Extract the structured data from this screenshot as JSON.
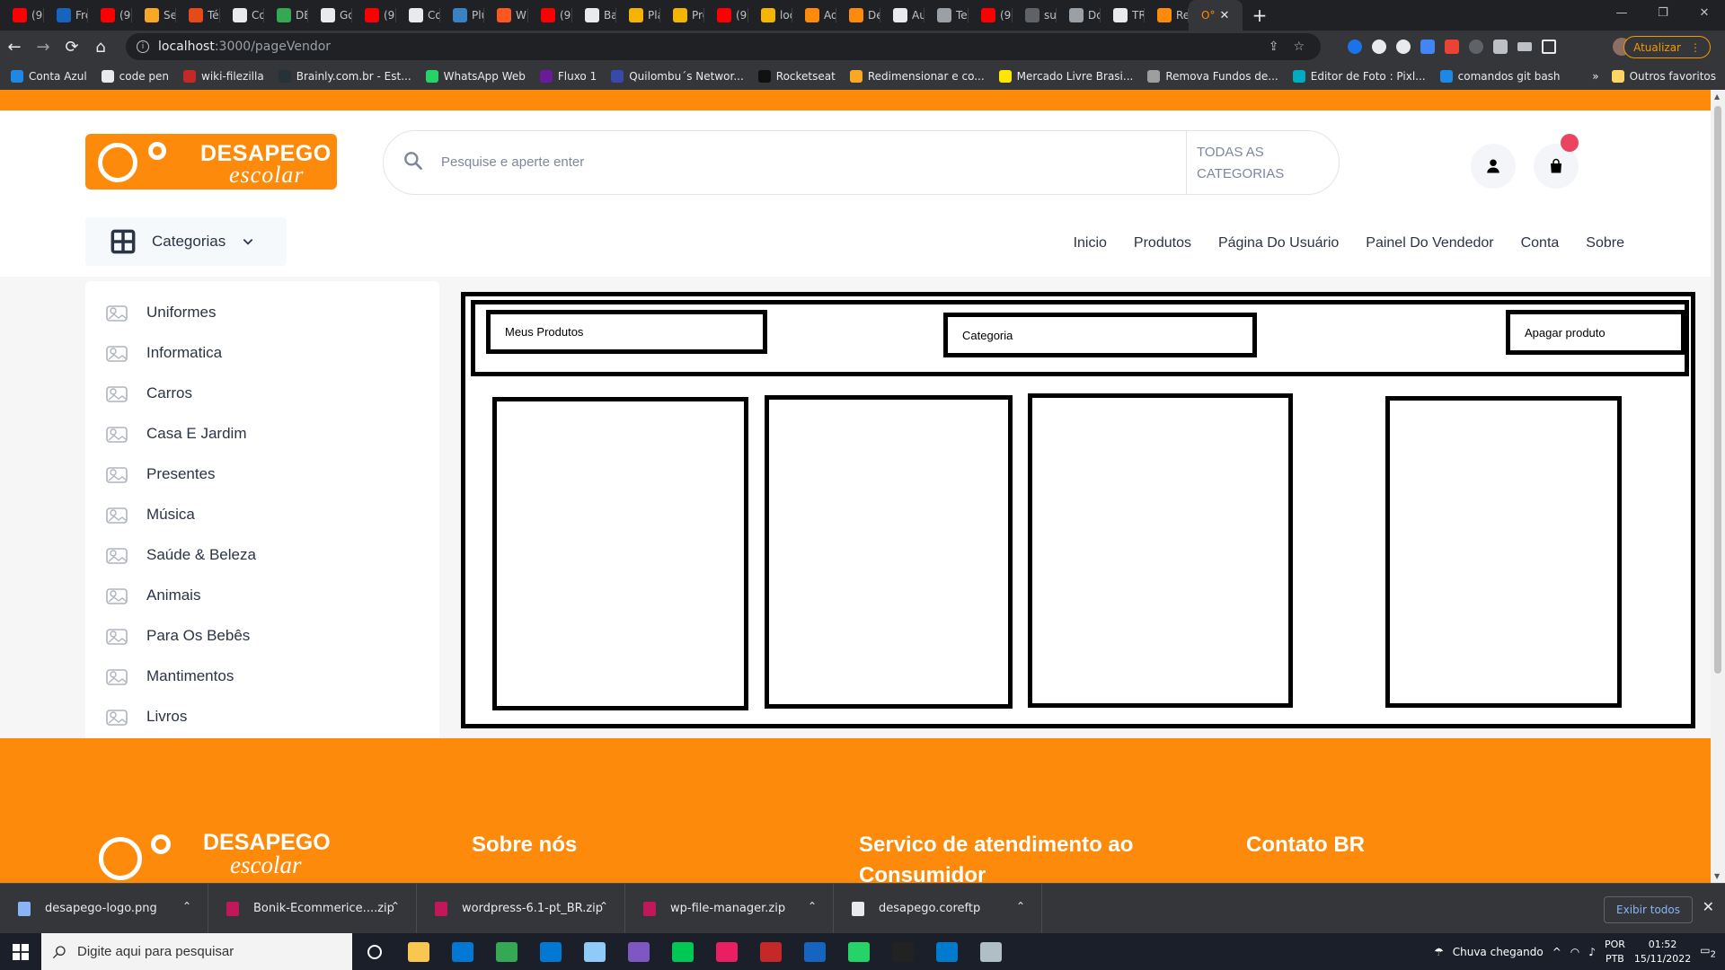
{
  "browser": {
    "tabs": [
      {
        "label": "(90",
        "color": "#ff0000"
      },
      {
        "label": "Fre",
        "color": "#1565c0"
      },
      {
        "label": "(90",
        "color": "#ff0000"
      },
      {
        "label": "Ser",
        "color": "#f9a825"
      },
      {
        "label": "Téc",
        "color": "#e64a19"
      },
      {
        "label": "Co",
        "color": "#e8eaed"
      },
      {
        "label": "DE",
        "color": "#34a853"
      },
      {
        "label": "Go",
        "color": "#e8eaed"
      },
      {
        "label": "(90",
        "color": "#ff0000"
      },
      {
        "label": "Co",
        "color": "#e8eaed"
      },
      {
        "label": "Plu",
        "color": "#3b82c4"
      },
      {
        "label": "WF",
        "color": "#ff5722"
      },
      {
        "label": "(90",
        "color": "#ff0000"
      },
      {
        "label": "Bai",
        "color": "#e8eaed"
      },
      {
        "label": "Pla",
        "color": "#f4b400"
      },
      {
        "label": "Pro",
        "color": "#f4b400"
      },
      {
        "label": "(90",
        "color": "#ff0000"
      },
      {
        "label": "loc",
        "color": "#f4b400"
      },
      {
        "label": "Ad",
        "color": "#fd8a0a"
      },
      {
        "label": "De",
        "color": "#fd8a0a"
      },
      {
        "label": "Au",
        "color": "#e8eaed"
      },
      {
        "label": "Tes",
        "color": "#9aa0a6"
      },
      {
        "label": "(90",
        "color": "#ff0000"
      },
      {
        "label": "sur",
        "color": "#5f6368"
      },
      {
        "label": "Do",
        "color": "#9aa0a6"
      },
      {
        "label": "TR",
        "color": "#e8eaed"
      },
      {
        "label": "Rea",
        "color": "#fd8a0a"
      }
    ],
    "active_tab": {
      "label": "O°",
      "close": "✕"
    },
    "new_tab": "+",
    "url_host": "localhost",
    "url_path": ":3000/pageVendor",
    "update_label": "Atualizar",
    "bookmarks": [
      {
        "label": "Conta Azul",
        "color": "#1e88e5"
      },
      {
        "label": "code pen",
        "color": "#e8eaed"
      },
      {
        "label": "wiki-filezilla",
        "color": "#c62828"
      },
      {
        "label": "Brainly.com.br - Est...",
        "color": "#263238"
      },
      {
        "label": "WhatsApp Web",
        "color": "#25d366"
      },
      {
        "label": "Fluxo 1",
        "color": "#6a1b9a"
      },
      {
        "label": "Quilombu´s Networ...",
        "color": "#3949ab"
      },
      {
        "label": "Rocketseat",
        "color": "#111111"
      },
      {
        "label": "Redimensionar e co...",
        "color": "#f9a825"
      },
      {
        "label": "Mercado Livre Brasi...",
        "color": "#ffe600"
      },
      {
        "label": "Remova Fundos de...",
        "color": "#9e9e9e"
      },
      {
        "label": "Editor de Foto : Pixl...",
        "color": "#00acc1"
      },
      {
        "label": "comandos git bash",
        "color": "#1e88e5"
      }
    ],
    "bookmarks_more": "»",
    "other_bookmarks": "Outros favoritos"
  },
  "site": {
    "brand_color": "#fd8a0a",
    "logo": {
      "line1": "DESAPEGO",
      "line2": "escolar"
    },
    "search_placeholder": "Pesquise e aperte enter",
    "all_categories": "TODAS AS CATEGORIAS",
    "categories_button": "Categorias",
    "nav": [
      "Inicio",
      "Produtos",
      "Página Do Usuário",
      "Painel Do Vendedor",
      "Conta",
      "Sobre"
    ],
    "sidebar": [
      {
        "label": "Uniformes",
        "icon": "shirt-icon"
      },
      {
        "label": "Informatica",
        "icon": "laptop-icon"
      },
      {
        "label": "Carros",
        "icon": "car-icon"
      },
      {
        "label": "Casa E Jardim",
        "icon": "house-garden-icon"
      },
      {
        "label": "Presentes",
        "icon": "gift-icon"
      },
      {
        "label": "Música",
        "icon": "music-icon"
      },
      {
        "label": "Saúde & Beleza",
        "icon": "beauty-icon"
      },
      {
        "label": "Animais",
        "icon": "pet-icon"
      },
      {
        "label": "Para Os Bebês",
        "icon": "baby-icon"
      },
      {
        "label": "Mantimentos",
        "icon": "groceries-icon"
      },
      {
        "label": "Livros",
        "icon": "books-icon"
      }
    ],
    "vendor_panel": {
      "my_products": "Meus Produtos",
      "category": "Categoria",
      "delete_product": "Apagar produto",
      "card_count": 4
    },
    "footer": {
      "logo": {
        "line1": "DESAPEGO",
        "line2": "escolar"
      },
      "col1": "Sobre nós",
      "col2": "Servico de atendimento ao Consumidor",
      "col3": "Contato BR"
    }
  },
  "downloads": {
    "items": [
      {
        "name": "desapego-logo.png",
        "color": "#8ab4f8"
      },
      {
        "name": "Bonik-Ecommerice....zip",
        "color": "#c2185b"
      },
      {
        "name": "wordpress-6.1-pt_BR.zip",
        "color": "#c2185b"
      },
      {
        "name": "wp-file-manager.zip",
        "color": "#c2185b"
      },
      {
        "name": "desapego.coreftp",
        "color": "#e8eaed"
      }
    ],
    "show_all": "Exibir todos",
    "close": "✕"
  },
  "taskbar": {
    "search_placeholder": "Digite aqui para pesquisar",
    "apps": [
      {
        "name": "task-view",
        "color": "#ffffff"
      },
      {
        "name": "file-explorer",
        "color": "#f9c74f"
      },
      {
        "name": "microsoft-store",
        "color": "#0078d4"
      },
      {
        "name": "chrome",
        "color": "#34a853"
      },
      {
        "name": "mail",
        "color": "#0078d4"
      },
      {
        "name": "app",
        "color": "#90caf9"
      },
      {
        "name": "app",
        "color": "#7e57c2"
      },
      {
        "name": "app",
        "color": "#00c853"
      },
      {
        "name": "itunes",
        "color": "#e91e63"
      },
      {
        "name": "filezilla",
        "color": "#c62828"
      },
      {
        "name": "app",
        "color": "#1565c0"
      },
      {
        "name": "whatsapp",
        "color": "#25d366"
      },
      {
        "name": "terminal",
        "color": "#222222"
      },
      {
        "name": "vscode",
        "color": "#007acc"
      },
      {
        "name": "app",
        "color": "#b0bec5"
      }
    ],
    "weather": "Chuva chegando",
    "lang": "POR",
    "layout": "PTB",
    "time": "01:52",
    "date": "15/11/2022",
    "notifications": "2"
  }
}
